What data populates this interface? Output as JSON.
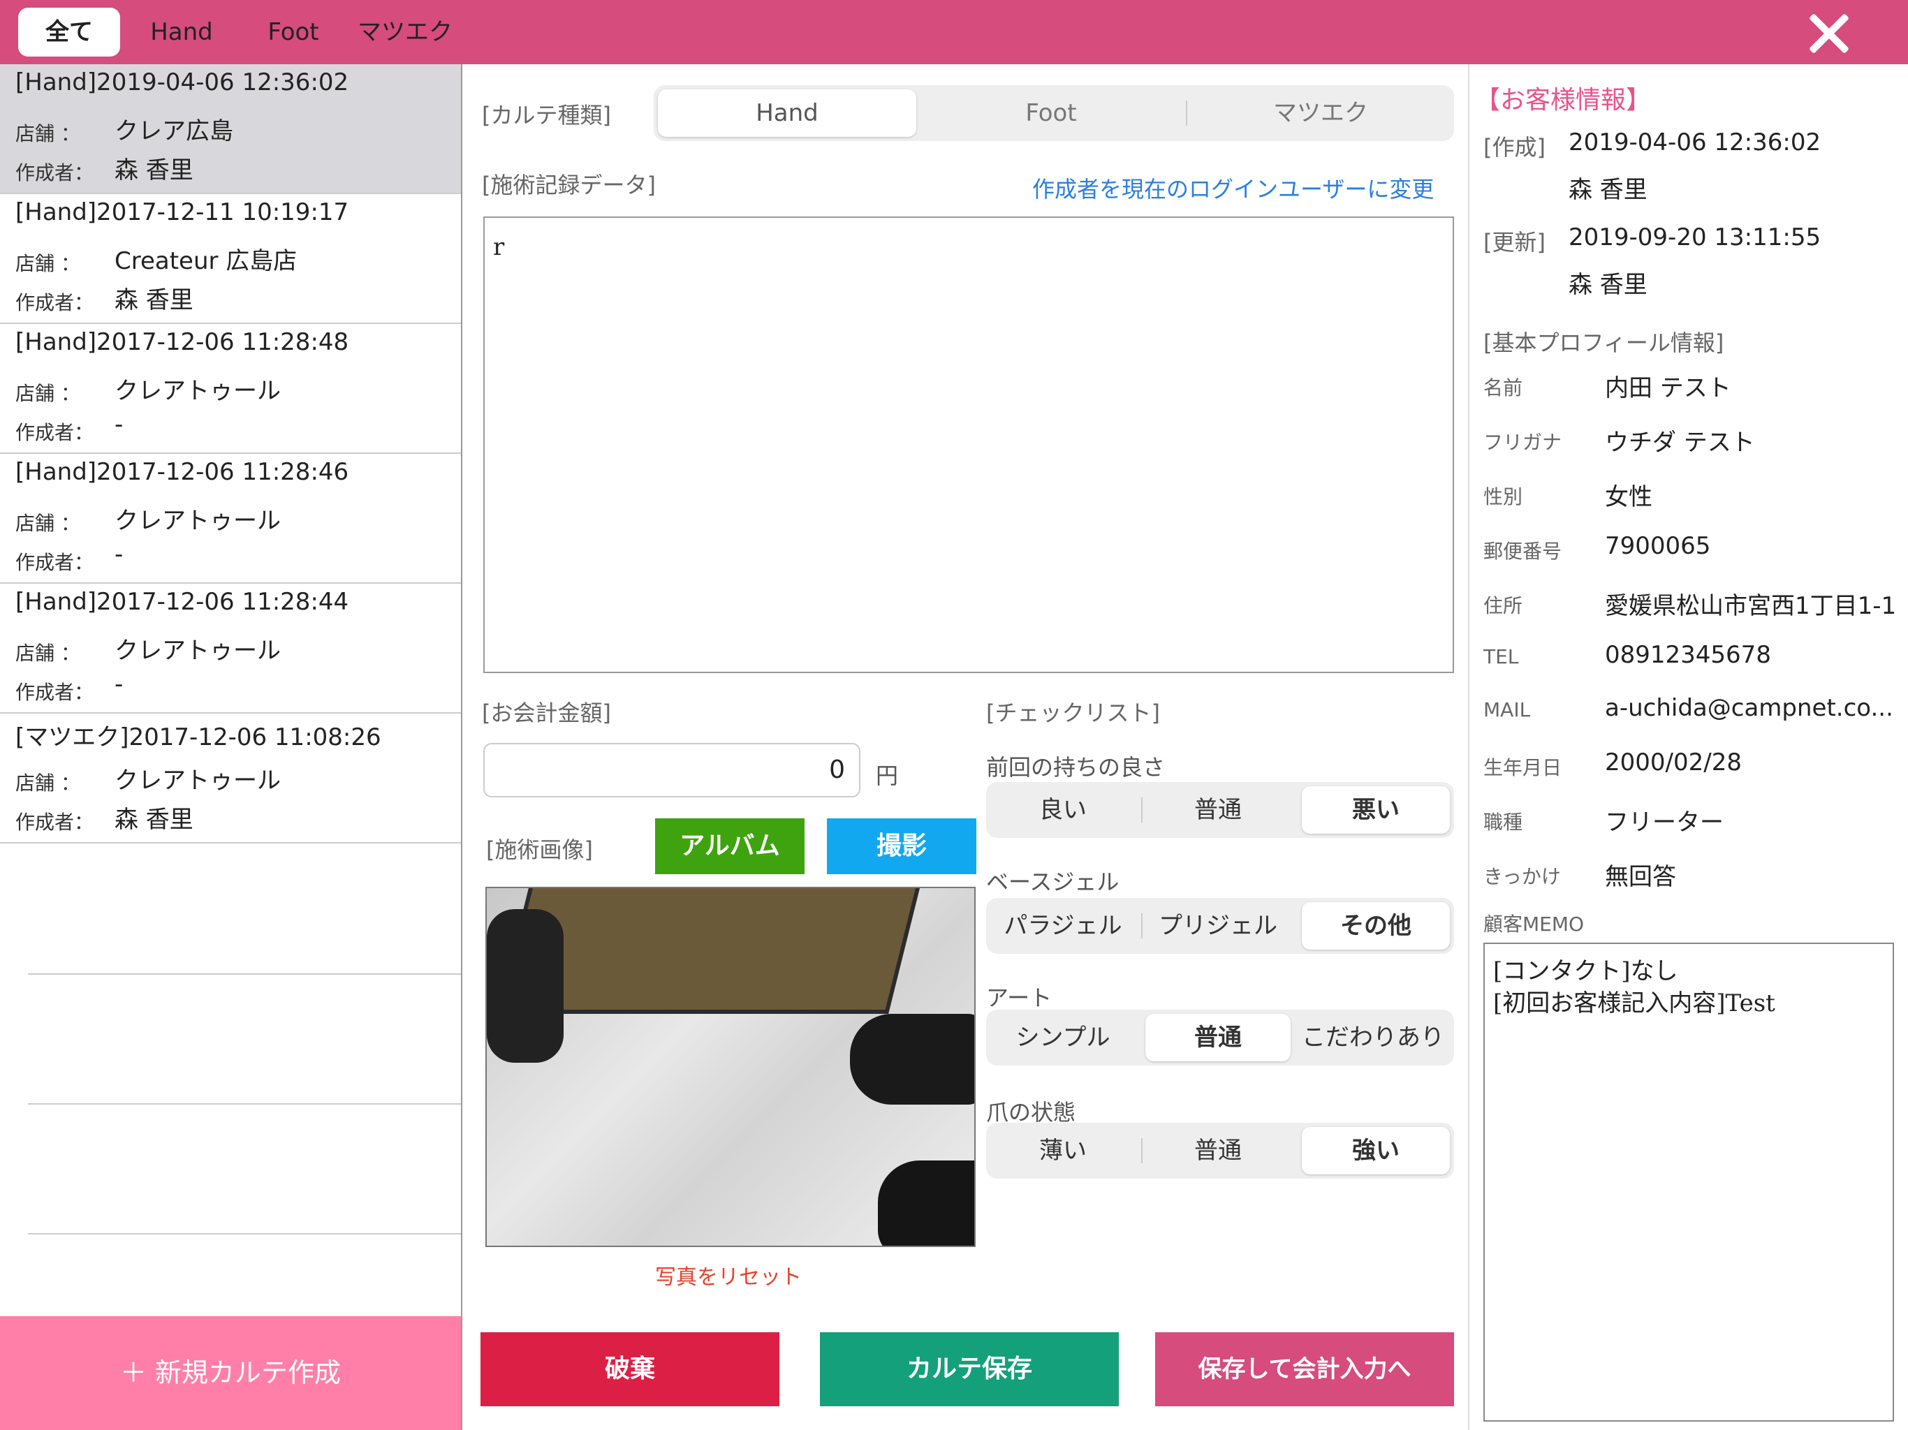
{
  "top_tabs": [
    "全て",
    "Hand",
    "Foot",
    "マツエク"
  ],
  "records": [
    {
      "title": "[Hand]2019-04-06 12:36:02",
      "store_label": "店舗 ：",
      "store": "クレア広島",
      "author_label": "作成者：",
      "author": "森 香里"
    },
    {
      "title": "[Hand]2017-12-11 10:19:17",
      "store_label": "店舗 ：",
      "store": "Createur 広島店",
      "author_label": "作成者：",
      "author": "森 香里"
    },
    {
      "title": "[Hand]2017-12-06 11:28:48",
      "store_label": "店舗 ：",
      "store": "クレアトゥール",
      "author_label": "作成者：",
      "author": "-"
    },
    {
      "title": "[Hand]2017-12-06 11:28:46",
      "store_label": "店舗 ：",
      "store": "クレアトゥール",
      "author_label": "作成者：",
      "author": "-"
    },
    {
      "title": "[Hand]2017-12-06 11:28:44",
      "store_label": "店舗 ：",
      "store": "クレアトゥール",
      "author_label": "作成者：",
      "author": "-"
    },
    {
      "title": "[マツエク]2017-12-06 11:08:26",
      "store_label": "店舗 ：",
      "store": "クレアトゥール",
      "author_label": "作成者：",
      "author": "森 香里"
    }
  ],
  "new_record_button": "＋ 新規カルテ作成",
  "main": {
    "kind_label": "[カルテ種類]",
    "kinds": [
      "Hand",
      "Foot",
      "マツエク"
    ],
    "record_label": "[施術記録データ]",
    "change_author_link": "作成者を現在のログインユーザーに変更",
    "record_text": "r",
    "amount_label": "[お会計金額]",
    "amount_value": "0",
    "yen": "円",
    "image_label": "[施術画像]",
    "album_button": "アルバム",
    "camera_button": "撮影",
    "reset_photo": "写真をリセット",
    "checklist_label": "[チェックリスト]",
    "checklist": [
      {
        "title": "前回の持ちの良さ",
        "options": [
          "良い",
          "普通",
          "悪い"
        ],
        "selected": "悪い"
      },
      {
        "title": "ベースジェル",
        "options": [
          "パラジェル",
          "プリジェル",
          "その他"
        ],
        "selected": "その他"
      },
      {
        "title": "アート",
        "options": [
          "シンプル",
          "普通",
          "こだわりあり"
        ],
        "selected": "普通"
      },
      {
        "title": "爪の状態",
        "options": [
          "薄い",
          "普通",
          "強い"
        ],
        "selected": "強い"
      }
    ],
    "discard_button": "破棄",
    "save_button": "カルテ保存",
    "save_checkout_button": "保存して会計入力へ"
  },
  "customer": {
    "header": "【お客様情報】",
    "created_label": "[作成]",
    "created_at": "2019-04-06 12:36:02",
    "created_by": "森 香里",
    "updated_label": "[更新]",
    "updated_at": "2019-09-20 13:11:55",
    "updated_by": "森 香里",
    "profile_label": "[基本プロフィール情報]",
    "fields": [
      {
        "label": "名前",
        "value": "内田 テスト"
      },
      {
        "label": "フリガナ",
        "value": "ウチダ テスト"
      },
      {
        "label": "性別",
        "value": "女性"
      },
      {
        "label": "郵便番号",
        "value": "7900065"
      },
      {
        "label": "住所",
        "value": "愛媛県松山市宮西1丁目1-1"
      },
      {
        "label": "TEL",
        "value": "08912345678"
      },
      {
        "label": "MAIL",
        "value": "a-uchida@campnet.co..."
      },
      {
        "label": "生年月日",
        "value": "2000/02/28"
      },
      {
        "label": "職種",
        "value": "フリーター"
      },
      {
        "label": "きっかけ",
        "value": "無回答"
      }
    ],
    "memo_label": "顧客MEMO",
    "memo_line1": "[コンタクト]なし",
    "memo_line2": "[初回お客様記入内容]Test"
  },
  "colors": {
    "topbar": "#d64c7c",
    "new_button": "#ff7fa8",
    "discard": "#dc1f44",
    "save": "#14a07a",
    "save_checkout": "#d64c7c",
    "album": "#3ea30f",
    "camera": "#12a8f0",
    "link": "#2a7fe0",
    "accent": "#e8538a"
  }
}
